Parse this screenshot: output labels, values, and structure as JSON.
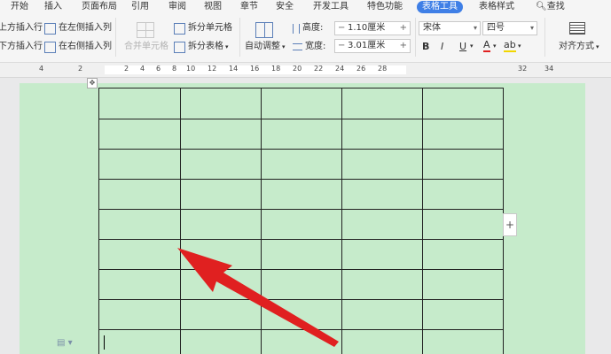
{
  "menu": [
    "开始",
    "插入",
    "页面布局",
    "引用",
    "审阅",
    "视图",
    "章节",
    "安全",
    "开发工具",
    "特色功能",
    "表格工具",
    "表格样式",
    "查找"
  ],
  "ribbon": {
    "insert_above": "上方插入行",
    "insert_left": "在左侧插入列",
    "insert_below": "下方插入行",
    "insert_right": "在右侧插入列",
    "merge_cells": "合并单元格",
    "split_cells": "拆分单元格",
    "split_table": "拆分表格",
    "auto_adjust": "自动调整",
    "height_label": "高度:",
    "height_value": "1.10厘米",
    "width_label": "宽度:",
    "width_value": "3.01厘米",
    "font_name": "宋体",
    "font_size": "四号",
    "bold": "B",
    "italic": "I",
    "underline": "U",
    "font_color": "A",
    "align_label": "对齐方式"
  },
  "ruler_numbers": [
    "4",
    "2",
    "2",
    "4",
    "6",
    "8",
    "10",
    "12",
    "14",
    "16",
    "18",
    "20",
    "22",
    "24",
    "26",
    "28",
    "32",
    "34"
  ],
  "table": {
    "add_button": "+",
    "move_handle": "✥"
  },
  "colors": {
    "page_bg": "#c6ebcb",
    "active_tab": "#3f7fe6",
    "arrow": "#e02020"
  }
}
